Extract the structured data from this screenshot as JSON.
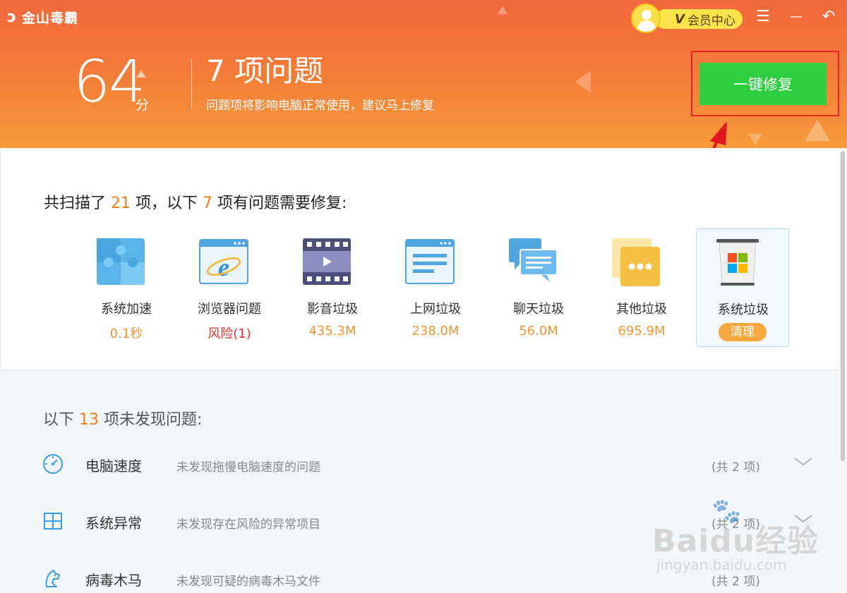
{
  "app": {
    "logo_mark": "ↄ",
    "name": "金山毒霸"
  },
  "vip": {
    "v_badge": "V",
    "label": "会员中心"
  },
  "window_controls": {
    "menu": "☰",
    "minimize": "—",
    "back": "↶"
  },
  "summary": {
    "score": "64",
    "score_unit": "分",
    "issue_title": "7 项问题",
    "issue_subtitle": "问题项将影响电脑正常使用，建议马上修复",
    "fix_button": "一键修复"
  },
  "scan": {
    "title_prefix": "共扫描了",
    "total": "21",
    "title_mid": "项，以下",
    "issue_count": "7",
    "title_suffix": "项有问题需要修复:",
    "items": [
      {
        "icon": "puzzle-icon",
        "name": "系统加速",
        "value": "0.1秒"
      },
      {
        "icon": "ie-browser-icon",
        "name": "浏览器问题",
        "value": "风险(1)"
      },
      {
        "icon": "film-icon",
        "name": "影音垃圾",
        "value": "435.3M"
      },
      {
        "icon": "web-page-icon",
        "name": "上网垃圾",
        "value": "238.0M"
      },
      {
        "icon": "chat-bubbles-icon",
        "name": "聊天垃圾",
        "value": "56.0M"
      },
      {
        "icon": "folder-more-icon",
        "name": "其他垃圾",
        "value": "695.9M"
      },
      {
        "icon": "windows-trash-icon",
        "name": "系统垃圾",
        "action": "清理"
      }
    ]
  },
  "no_issue": {
    "title_prefix": "以下",
    "count": "13",
    "title_suffix": "项未发现问题:",
    "rows": [
      {
        "icon": "speedometer-icon",
        "name": "电脑速度",
        "desc": "未发现拖慢电脑速度的问题",
        "count": "(共 2 项)"
      },
      {
        "icon": "windows-logo-icon",
        "name": "系统异常",
        "desc": "未发现存在风险的异常项目",
        "count": "(共 2 项)"
      },
      {
        "icon": "horse-icon",
        "name": "病毒木马",
        "desc": "未发现可疑的病毒木马文件",
        "count": "(共 2 项)"
      }
    ]
  },
  "watermark": {
    "main": "Baidu经验",
    "sub": "jingyan.baidu.com"
  },
  "colors": {
    "header": "#f47a38",
    "fix_button": "#2dcf40",
    "highlight": "#e8212a",
    "accent": "#f07d1a"
  }
}
